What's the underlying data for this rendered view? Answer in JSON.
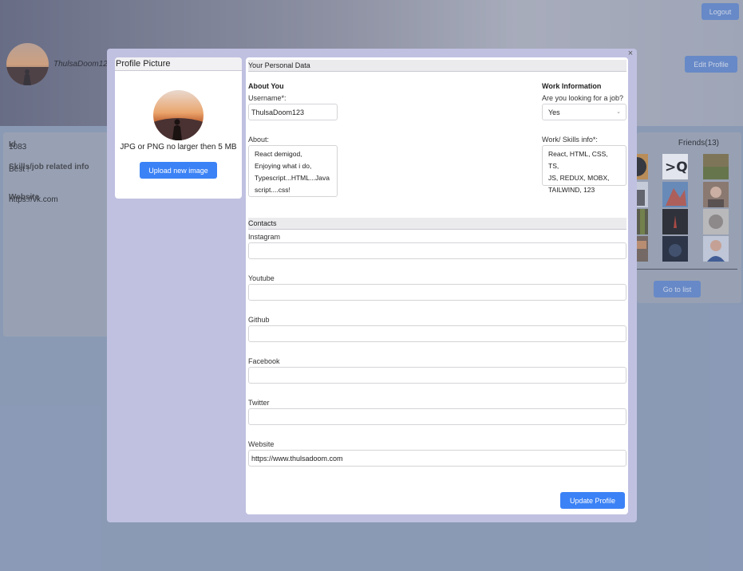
{
  "header": {
    "logout_label": "Logout",
    "edit_profile_label": "Edit Profile",
    "username": "ThulsaDoom12"
  },
  "info": {
    "id_label": "Id",
    "id_value": "1083",
    "skills_label": "Skills/job related info",
    "skills_value": "Best !",
    "website_label": "Website",
    "website_value": "https://vk.com"
  },
  "friends": {
    "title": "Friends(13)",
    "go_to_list_label": "Go to list"
  },
  "modal": {
    "close_icon": "×",
    "picture": {
      "title": "Profile Picture",
      "note": "JPG or PNG no larger then 5 MB",
      "upload_label": "Upload new image"
    },
    "personal": {
      "title": "Your Personal Data",
      "about_section": "About You",
      "username_label": "Username*:",
      "username_value": "ThulsaDoom123",
      "about_label": "About:",
      "about_value": "React demigod,\nEnjoying what i do,\nTypescript...HTML...Java\nscript....css!",
      "work_section": "Work Information",
      "looking_label": "Are you looking for a job?",
      "looking_value": "Yes",
      "skills_label": "Work/ Skills info*:",
      "skills_value": "React, HTML, CSS, TS,\nJS, REDUX, MOBX,\nTAILWIND, 123"
    },
    "contacts": {
      "title": "Contacts",
      "instagram_label": "Instagram",
      "instagram_value": "",
      "youtube_label": "Youtube",
      "youtube_value": "",
      "github_label": "Github",
      "github_value": "",
      "facebook_label": "Facebook",
      "facebook_value": "",
      "twitter_label": "Twitter",
      "twitter_value": "",
      "website_label": "Website",
      "website_value": "https://www.thulsadoom.com"
    },
    "update_label": "Update Profile"
  }
}
